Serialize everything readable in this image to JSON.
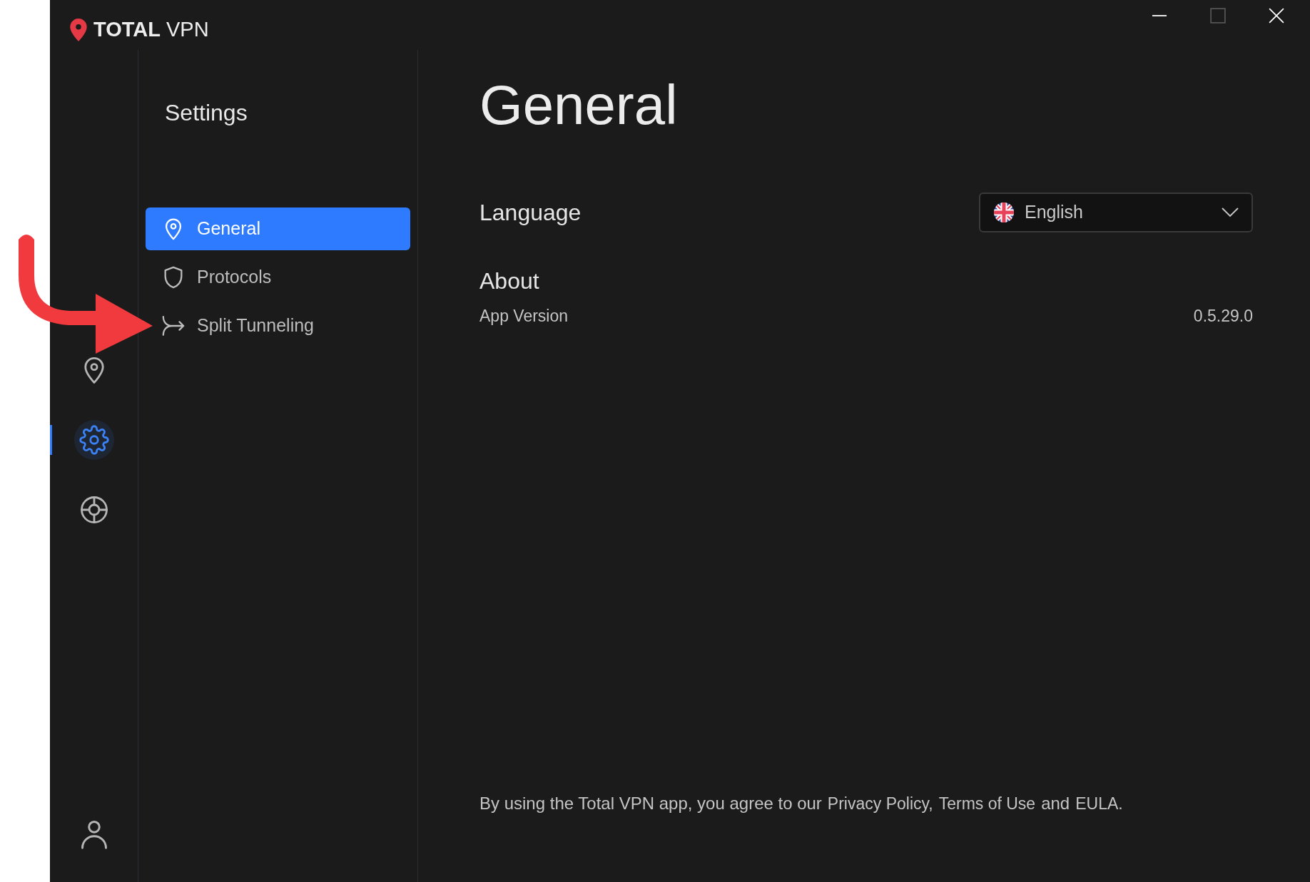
{
  "app": {
    "logo_bold": "TOTAL",
    "logo_light": "VPN"
  },
  "window_controls": [
    {
      "kind": "minimize",
      "disabled": false
    },
    {
      "kind": "maximize",
      "disabled": true
    },
    {
      "kind": "close",
      "disabled": false
    }
  ],
  "rail": [
    {
      "kind": "location",
      "selected": false
    },
    {
      "kind": "settings",
      "selected": true
    },
    {
      "kind": "support",
      "selected": false
    }
  ],
  "account": {
    "kind": "account"
  },
  "settings_nav": {
    "title": "Settings",
    "items": [
      {
        "kind": "location",
        "label": "General",
        "selected": true
      },
      {
        "kind": "shield",
        "label": "Protocols",
        "selected": false
      },
      {
        "kind": "split",
        "label": "Split Tunneling",
        "selected": false
      }
    ]
  },
  "page": {
    "title": "General",
    "language": {
      "label": "Language",
      "value": "English"
    },
    "about": {
      "title": "About",
      "rows": [
        {
          "label": "App Version",
          "value": "0.5.29.0"
        }
      ]
    }
  },
  "footer": [
    {
      "kind": "text",
      "text": "By using the Total VPN app, you agree to our"
    },
    {
      "kind": "link",
      "text": "Privacy Policy,"
    },
    {
      "kind": "link",
      "text": "Terms of Use"
    },
    {
      "kind": "text",
      "text": "and"
    },
    {
      "kind": "link",
      "text": "EULA."
    }
  ]
}
